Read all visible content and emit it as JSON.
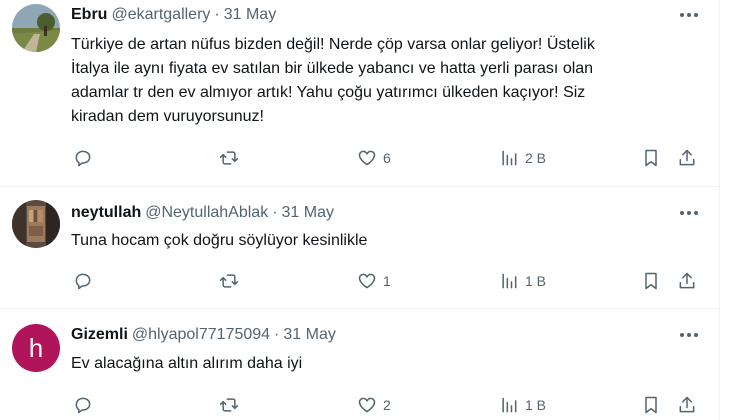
{
  "colors": {
    "text": "#0f1419",
    "secondary": "#536471",
    "divider": "#eff3f4",
    "avatar_h_bg": "#b0145a"
  },
  "tweets": [
    {
      "name": "Ebru",
      "handle": "@ekartgallery",
      "separator": "·",
      "date": "31 May",
      "avatar": "landscape-photo",
      "lines": [
        "Türkiye de artan nüfus bizden değil! Nerde çöp varsa onlar geliyor! Üstelik",
        "İtalya ile aynı fiyata ev satılan bir ülkede yabancı ve hatta yerli parası olan",
        "adamlar tr den ev almıyor artık! Yahu çoğu yatırımcı ülkeden kaçıyor! Siz",
        "kiradan dem vuruyorsunuz!"
      ],
      "likes": "6",
      "views": "2 B"
    },
    {
      "name": "neytullah",
      "handle": "@NeytullahAblak",
      "separator": "·",
      "date": "31 May",
      "avatar": "bookshelf-photo",
      "lines": [
        "Tuna hocam çok doğru söylüyor kesinlikle"
      ],
      "likes": "1",
      "views": "1 B"
    },
    {
      "name": "Gizemli",
      "handle": "@hlyapol77175094",
      "separator": "·",
      "date": "31 May",
      "avatar_letter": "h",
      "lines": [
        "Ev alacağına altın alırım daha iyi"
      ],
      "likes": "2",
      "views": "1 B"
    }
  ],
  "icons": [
    "more-icon",
    "reply-icon",
    "retweet-icon",
    "like-icon",
    "views-icon",
    "bookmark-icon",
    "share-icon"
  ]
}
